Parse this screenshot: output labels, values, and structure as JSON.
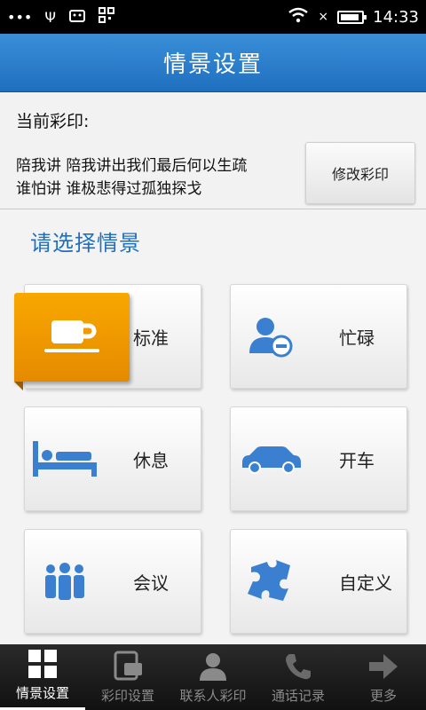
{
  "status_bar": {
    "time": "14:33",
    "icons": [
      "more-icon",
      "usb-icon",
      "android-debug-icon",
      "qr-icon",
      "wifi-icon",
      "no-signal-icon",
      "battery-icon"
    ]
  },
  "header": {
    "title": "情景设置"
  },
  "current": {
    "label": "当前彩印:",
    "song_line1": "陪我讲 陪我讲出我们最后何以生疏",
    "song_line2": "谁怕讲 谁极悲得过孤独探戈",
    "modify_button": "修改彩印"
  },
  "section_title": "请选择情景",
  "scenes": [
    {
      "label": "标准",
      "icon": "coffee-icon",
      "selected": true
    },
    {
      "label": "忙碌",
      "icon": "busy-user-icon",
      "selected": false
    },
    {
      "label": "休息",
      "icon": "bed-icon",
      "selected": false
    },
    {
      "label": "开车",
      "icon": "car-icon",
      "selected": false
    },
    {
      "label": "会议",
      "icon": "meeting-icon",
      "selected": false
    },
    {
      "label": "自定义",
      "icon": "puzzle-icon",
      "selected": false
    }
  ],
  "bottom_nav": [
    {
      "label": "情景设置",
      "icon": "grid-icon",
      "active": true
    },
    {
      "label": "彩印设置",
      "icon": "phone-screen-icon",
      "active": false
    },
    {
      "label": "联系人彩印",
      "icon": "contact-icon",
      "active": false
    },
    {
      "label": "通话记录",
      "icon": "call-log-icon",
      "active": false
    },
    {
      "label": "更多",
      "icon": "arrow-right-icon",
      "active": false
    }
  ],
  "colors": {
    "header": "#1f6fbf",
    "accent_blue": "#3b7fd0",
    "selected_tag": "#f29a00"
  }
}
